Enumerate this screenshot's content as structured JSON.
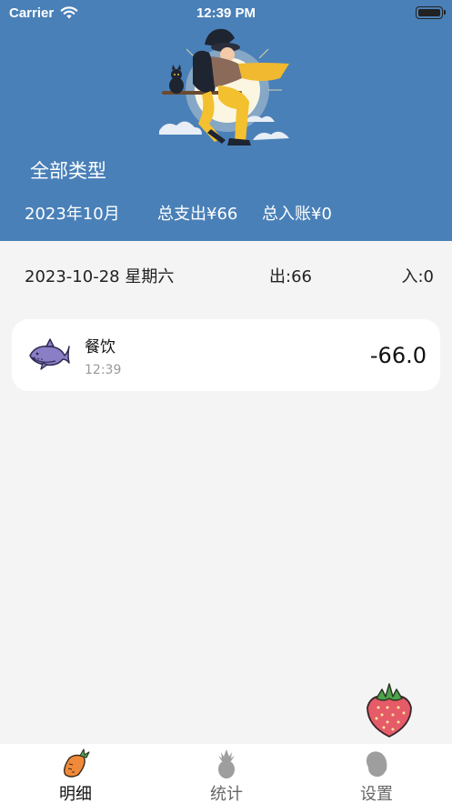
{
  "status_bar": {
    "carrier": "Carrier",
    "time": "12:39 PM"
  },
  "header": {
    "category": "全部类型",
    "month": "2023年10月",
    "total_expense": "总支出¥66",
    "total_income": "总入账¥0"
  },
  "day": {
    "date": "2023-10-28 星期六",
    "out": "出:66",
    "in": "入:0"
  },
  "records": [
    {
      "name": "餐饮",
      "time": "12:39",
      "amount": "-66.0",
      "icon": "whale-icon"
    }
  ],
  "tabs": [
    {
      "label": "明细",
      "icon": "carrot-icon",
      "active": true
    },
    {
      "label": "统计",
      "icon": "pineapple-icon",
      "active": false
    },
    {
      "label": "设置",
      "icon": "papaya-icon",
      "active": false
    }
  ],
  "fab": {
    "icon": "strawberry-icon"
  },
  "colors": {
    "header": "#4a80b8",
    "background": "#f4f4f4",
    "card": "#ffffff"
  }
}
